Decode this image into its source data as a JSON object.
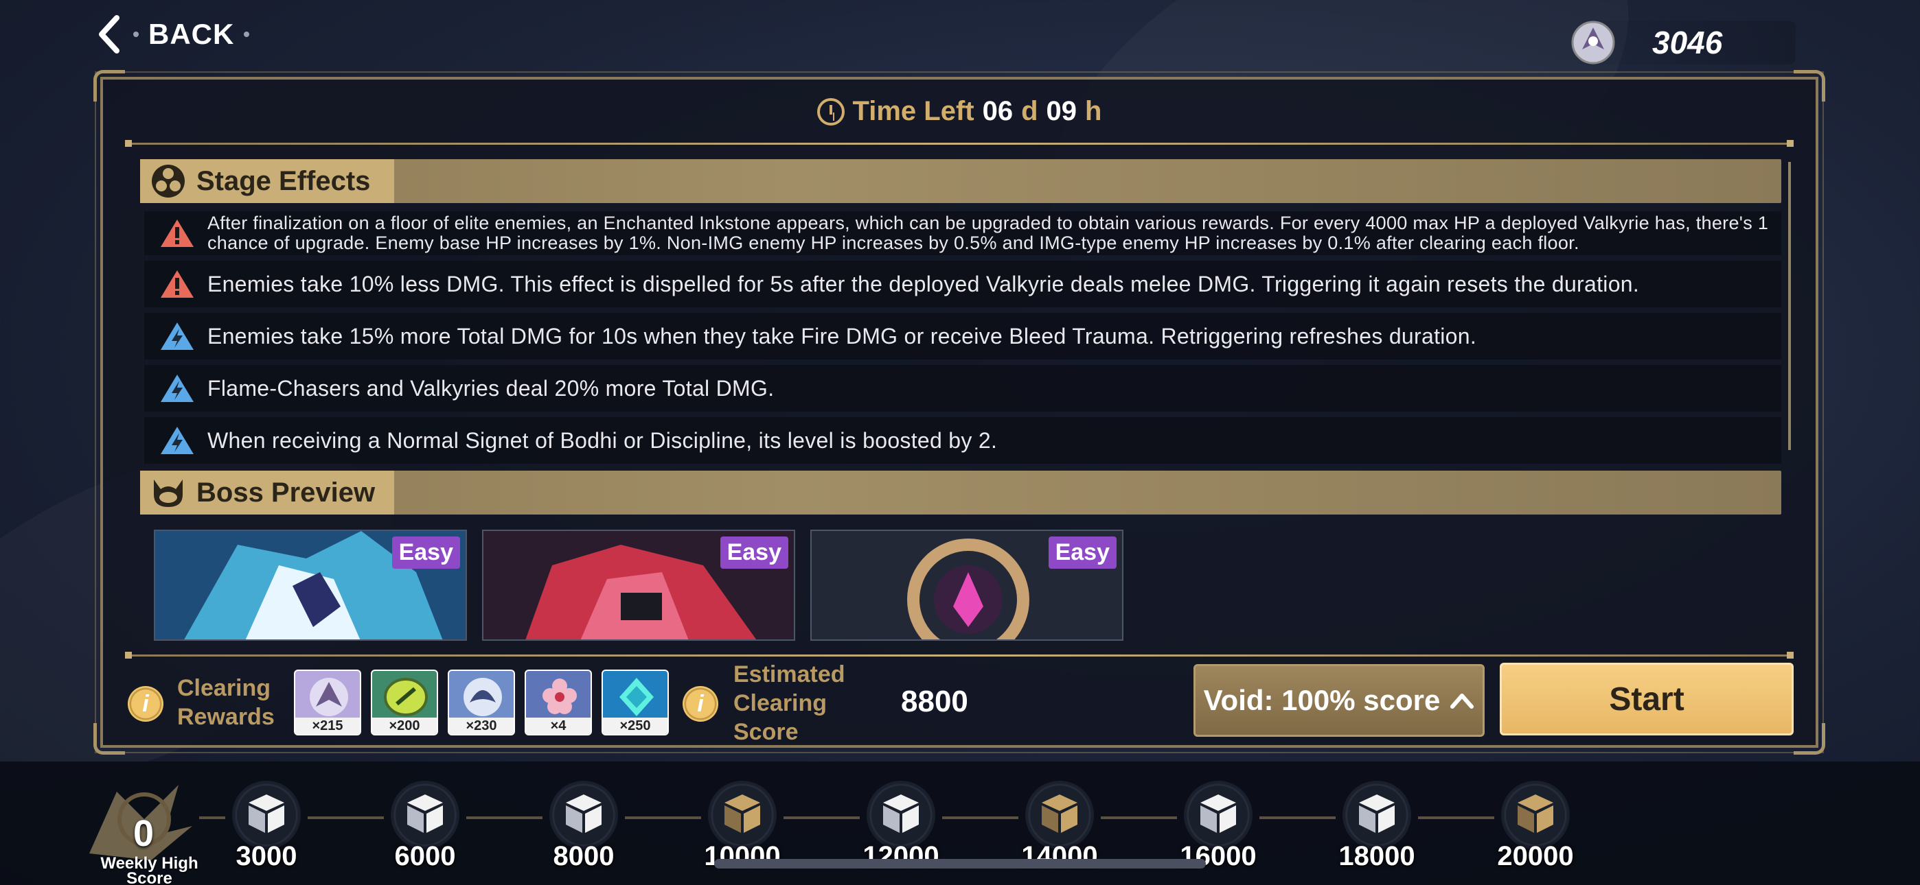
{
  "topbar": {
    "back_label": "BACK",
    "currency_value": "3046",
    "currency_icon": "valkyrie-emblem-icon"
  },
  "timer": {
    "prefix": "Time Left",
    "days": "06",
    "days_unit": "d",
    "hours": "09",
    "hours_unit": "h"
  },
  "stage_effects": {
    "title": "Stage Effects",
    "items": [
      {
        "icon": "warning-icon",
        "color": "#e86a5a",
        "text": "After finalization on a floor of elite enemies, an Enchanted Inkstone appears, which can be upgraded to obtain various rewards. For every 4000 max HP a deployed Valkyrie has, there's 1 chance of upgrade. Enemy base HP increases by 1%. Non-IMG enemy HP increases by 0.5% and IMG-type enemy HP increases by 0.1% after clearing each floor."
      },
      {
        "icon": "warning-icon",
        "color": "#e86a5a",
        "text": "Enemies take 10% less DMG. This effect is dispelled for 5s after the deployed Valkyrie deals melee DMG. Triggering it again resets the duration."
      },
      {
        "icon": "lightning-icon",
        "color": "#5aa8e8",
        "text": "Enemies take 15% more Total DMG for 10s when they take Fire DMG or receive Bleed Trauma. Retriggering refreshes duration."
      },
      {
        "icon": "lightning-icon",
        "color": "#5aa8e8",
        "text": "Flame-Chasers and Valkyries deal 20% more Total DMG."
      },
      {
        "icon": "lightning-icon",
        "color": "#5aa8e8",
        "text": "When receiving a Normal Signet of Bodhi or Discipline, its level is boosted by 2."
      }
    ]
  },
  "boss_preview": {
    "title": "Boss Preview",
    "bosses": [
      {
        "difficulty": "Easy"
      },
      {
        "difficulty": "Easy"
      },
      {
        "difficulty": "Easy"
      }
    ]
  },
  "clearing": {
    "rewards_label_line1": "Clearing",
    "rewards_label_line2": "Rewards",
    "rewards": [
      {
        "icon": "valkyrie-emblem-icon",
        "qty": "×215",
        "bg": "#b6a7dd"
      },
      {
        "icon": "coin-icon",
        "qty": "×200",
        "bg": "#3f8a6a"
      },
      {
        "icon": "bird-emblem-icon",
        "qty": "×230",
        "bg": "#6f8ec9"
      },
      {
        "icon": "flower-icon",
        "qty": "×4",
        "bg": "#5e76b8"
      },
      {
        "icon": "crystal-icon",
        "qty": "×250",
        "bg": "#1f7fbf"
      }
    ],
    "score_label_line1": "Estimated",
    "score_label_line2": "Clearing",
    "score_label_line3": "Score",
    "score_value": "8800"
  },
  "buttons": {
    "void_prefix": "Void: ",
    "void_value": "100%",
    "void_suffix": " score",
    "start_label": "Start"
  },
  "progress": {
    "weekly_score": "0",
    "weekly_label_line1": "Weekly High",
    "weekly_label_line2": "Score",
    "milestones": [
      {
        "value": "3000",
        "type": "white"
      },
      {
        "value": "6000",
        "type": "white"
      },
      {
        "value": "8000",
        "type": "white"
      },
      {
        "value": "10000",
        "type": "gold"
      },
      {
        "value": "12000",
        "type": "white"
      },
      {
        "value": "14000",
        "type": "gold"
      },
      {
        "value": "16000",
        "type": "white"
      },
      {
        "value": "18000",
        "type": "white"
      },
      {
        "value": "20000",
        "type": "gold"
      }
    ]
  }
}
